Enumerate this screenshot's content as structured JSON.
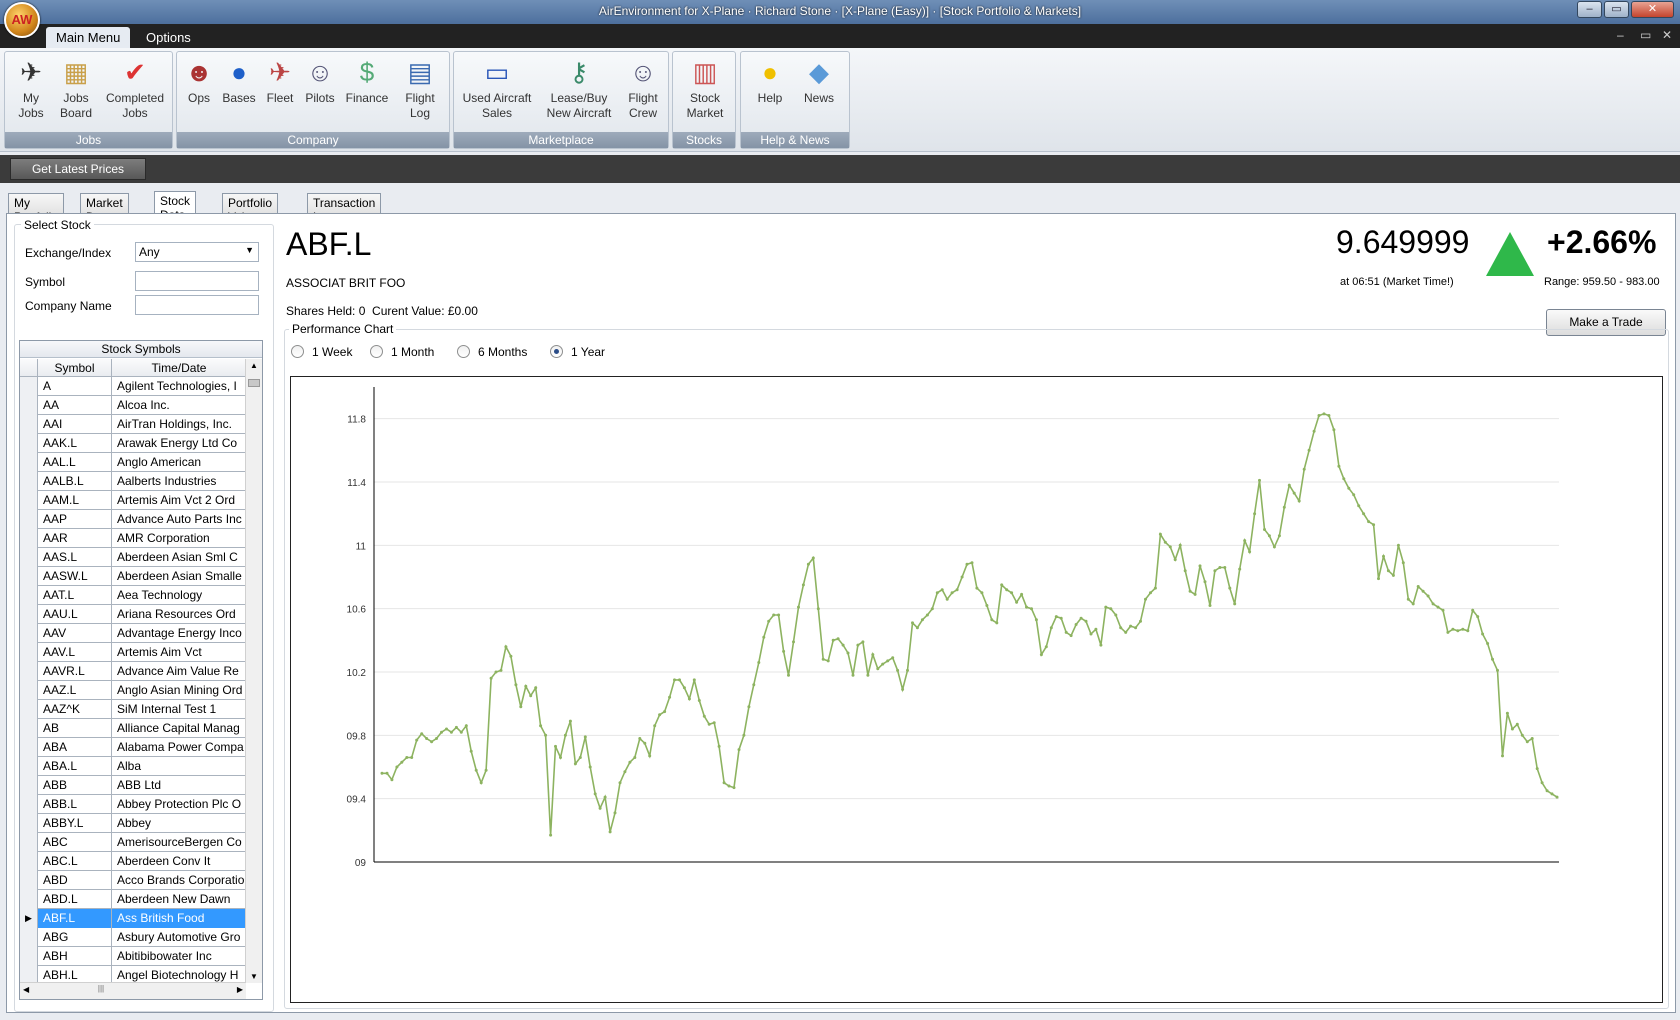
{
  "window": {
    "title": "AirEnvironment for X-Plane · Richard Stone · [X-Plane (Easy)] · [Stock Portfolio & Markets]",
    "logo": "AW",
    "min": "–",
    "max": "▭",
    "close": "✕"
  },
  "menu": {
    "tabs": [
      "Main Menu",
      "Options"
    ],
    "mdi": [
      "–",
      "▭",
      "✕"
    ]
  },
  "ribbon": {
    "groups": [
      {
        "caption": "Jobs",
        "buttons": [
          {
            "label": "My\nJobs",
            "icon": "airplane-pen-icon"
          },
          {
            "label": "Jobs\nBoard",
            "icon": "box-icon"
          },
          {
            "label": "Completed\nJobs",
            "icon": "checkmark-icon"
          }
        ]
      },
      {
        "caption": "Company",
        "buttons": [
          {
            "label": "Ops",
            "icon": "person-icon"
          },
          {
            "label": "Bases",
            "icon": "globe-icon"
          },
          {
            "label": "Fleet",
            "icon": "airplane-icon"
          },
          {
            "label": "Pilots",
            "icon": "pilot-icon"
          },
          {
            "label": "Finance",
            "icon": "money-icon"
          },
          {
            "label": "Flight\nLog",
            "icon": "book-icon"
          }
        ]
      },
      {
        "caption": "Marketplace",
        "buttons": [
          {
            "label": "Used Aircraft\nSales",
            "icon": "card-icon"
          },
          {
            "label": "Lease/Buy\nNew Aircraft",
            "icon": "keys-icon"
          },
          {
            "label": "Flight\nCrew",
            "icon": "crew-icon"
          }
        ]
      },
      {
        "caption": "Stocks",
        "buttons": [
          {
            "label": "Stock\nMarket",
            "icon": "books-icon"
          }
        ]
      },
      {
        "caption": "Help & News",
        "buttons": [
          {
            "label": "Help",
            "icon": "lightbulb-icon"
          },
          {
            "label": "News",
            "icon": "news-icon"
          }
        ]
      }
    ]
  },
  "toolbar": {
    "get_prices": "Get Latest Prices"
  },
  "tabs": [
    "My Portfolio",
    "Market Data",
    "Stock Data",
    "Portfolio Value",
    "Transaction Log"
  ],
  "select_stock": {
    "legend": "Select Stock",
    "exchange_label": "Exchange/Index",
    "exchange_value": "Any",
    "symbol_label": "Symbol",
    "symbol_value": "",
    "company_label": "Company Name",
    "company_value": ""
  },
  "grid": {
    "caption": "Stock Symbols",
    "col1": "Symbol",
    "col2": "Time/Date",
    "rows": [
      [
        "A",
        "Agilent Technologies, I"
      ],
      [
        "AA",
        "Alcoa Inc."
      ],
      [
        "AAI",
        "AirTran Holdings, Inc."
      ],
      [
        "AAK.L",
        "Arawak Energy Ltd Co"
      ],
      [
        "AAL.L",
        "Anglo American"
      ],
      [
        "AALB.L",
        "Aalberts Industries"
      ],
      [
        "AAM.L",
        "Artemis Aim Vct 2 Ord"
      ],
      [
        "AAP",
        "Advance Auto Parts Inc"
      ],
      [
        "AAR",
        "AMR Corporation"
      ],
      [
        "AAS.L",
        "Aberdeen Asian Sml C"
      ],
      [
        "AASW.L",
        "Aberdeen Asian Smalle"
      ],
      [
        "AAT.L",
        "Aea Technology"
      ],
      [
        "AAU.L",
        "Ariana Resources Ord"
      ],
      [
        "AAV",
        "Advantage Energy Inco"
      ],
      [
        "AAV.L",
        "Artemis Aim Vct"
      ],
      [
        "AAVR.L",
        "Advance Aim Value Re"
      ],
      [
        "AAZ.L",
        "Anglo Asian Mining Ord"
      ],
      [
        "AAZ^K",
        "SiM Internal Test 1"
      ],
      [
        "AB",
        "Alliance Capital Manag"
      ],
      [
        "ABA",
        "Alabama Power Compa"
      ],
      [
        "ABA.L",
        "Alba"
      ],
      [
        "ABB",
        "ABB Ltd"
      ],
      [
        "ABB.L",
        "Abbey Protection Plc O"
      ],
      [
        "ABBY.L",
        "Abbey"
      ],
      [
        "ABC",
        "AmerisourceBergen Co"
      ],
      [
        "ABC.L",
        "Aberdeen Conv It"
      ],
      [
        "ABD",
        "Acco Brands Corporatio"
      ],
      [
        "ABD.L",
        "Aberdeen New Dawn"
      ],
      [
        "ABF.L",
        "Ass British Food"
      ],
      [
        "ABG",
        "Asbury Automotive Gro"
      ],
      [
        "ABH",
        "Abitibibowater Inc"
      ],
      [
        "ABH.L",
        "Angel Biotechnology H"
      ]
    ],
    "selected": 28,
    "row_marker": "▶",
    "scroll_up": "▲",
    "scroll_down": "▼",
    "scroll_left": "◀",
    "scroll_right": "▶",
    "thumb": "|||"
  },
  "stock": {
    "symbol": "ABF.L",
    "name": "ASSOCIAT BRIT FOO",
    "shares": "Shares Held: 0  Curent Value: £0.00",
    "price": "9.649999",
    "change": "+2.66%",
    "time": "at 06:51 (Market Time!)",
    "range": "Range: 959.50 - 983.00",
    "trade_button": "Make a Trade"
  },
  "chart_opts": {
    "legend": "Performance Chart",
    "radios": [
      "1 Week",
      "1 Month",
      "6 Months",
      "1 Year"
    ],
    "selected": 3
  },
  "colors": {
    "line": "#8db360",
    "up_arrow": "#2fb84a",
    "selection": "#3399ff"
  },
  "chart_data": {
    "type": "line",
    "ylim": [
      9.0,
      12.0
    ],
    "ytick_labels": [
      "09",
      "09.4",
      "09.8",
      "10.2",
      "10.6",
      "11",
      "11.4",
      "11.8"
    ],
    "ytick_values": [
      9.0,
      9.4,
      9.8,
      10.2,
      10.6,
      11.0,
      11.4,
      11.8
    ],
    "values": [
      9.56,
      9.56,
      9.52,
      9.6,
      9.63,
      9.66,
      9.66,
      9.77,
      9.81,
      9.78,
      9.76,
      9.78,
      9.82,
      9.84,
      9.82,
      9.85,
      9.82,
      9.86,
      9.7,
      9.58,
      9.5,
      9.58,
      10.16,
      10.2,
      10.21,
      10.36,
      10.3,
      10.12,
      9.98,
      10.11,
      10.05,
      10.1,
      9.86,
      9.8,
      9.17,
      9.73,
      9.66,
      9.8,
      9.89,
      9.62,
      9.66,
      9.79,
      9.6,
      9.43,
      9.34,
      9.41,
      9.19,
      9.31,
      9.5,
      9.57,
      9.63,
      9.66,
      9.78,
      9.75,
      9.67,
      9.86,
      9.93,
      9.95,
      10.04,
      10.15,
      10.15,
      10.1,
      10.03,
      10.15,
      10.02,
      9.92,
      9.87,
      9.88,
      9.73,
      9.5,
      9.48,
      9.47,
      9.71,
      9.8,
      9.98,
      10.12,
      10.26,
      10.42,
      10.52,
      10.56,
      10.56,
      10.33,
      10.18,
      10.39,
      10.61,
      10.75,
      10.88,
      10.92,
      10.6,
      10.28,
      10.27,
      10.4,
      10.41,
      10.37,
      10.32,
      10.18,
      10.37,
      10.39,
      10.18,
      10.31,
      10.22,
      10.25,
      10.27,
      10.29,
      10.21,
      10.09,
      10.21,
      10.51,
      10.48,
      10.53,
      10.56,
      10.6,
      10.7,
      10.72,
      10.66,
      10.7,
      10.72,
      10.8,
      10.88,
      10.89,
      10.73,
      10.7,
      10.62,
      10.53,
      10.51,
      10.75,
      10.72,
      10.7,
      10.64,
      10.69,
      10.61,
      10.6,
      10.53,
      10.31,
      10.36,
      10.48,
      10.55,
      10.54,
      10.45,
      10.43,
      10.5,
      10.54,
      10.52,
      10.44,
      10.47,
      10.37,
      10.61,
      10.6,
      10.56,
      10.48,
      10.45,
      10.49,
      10.48,
      10.52,
      10.66,
      10.7,
      10.73,
      11.07,
      11.02,
      10.99,
      10.91,
      11.0,
      10.84,
      10.71,
      10.69,
      10.87,
      10.77,
      10.62,
      10.84,
      10.86,
      10.86,
      10.73,
      10.63,
      10.85,
      11.03,
      10.96,
      11.2,
      11.41,
      11.1,
      11.06,
      10.99,
      11.06,
      11.24,
      11.38,
      11.33,
      11.28,
      11.48,
      11.6,
      11.72,
      11.82,
      11.83,
      11.82,
      11.73,
      11.5,
      11.42,
      11.36,
      11.32,
      11.25,
      11.2,
      11.15,
      11.13,
      10.79,
      10.93,
      10.84,
      10.81,
      11.0,
      10.89,
      10.66,
      10.63,
      10.74,
      10.71,
      10.68,
      10.63,
      10.61,
      10.59,
      10.45,
      10.47,
      10.46,
      10.47,
      10.46,
      10.59,
      10.55,
      10.44,
      10.38,
      10.28,
      10.21,
      9.67,
      9.94,
      9.84,
      9.87,
      9.8,
      9.76,
      9.78,
      9.59,
      9.5,
      9.45,
      9.43,
      9.41
    ]
  }
}
